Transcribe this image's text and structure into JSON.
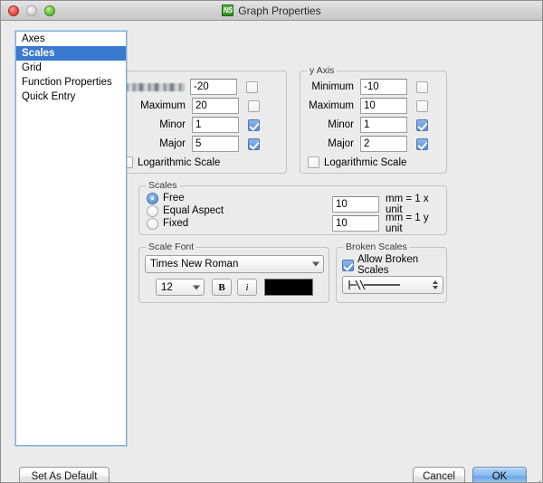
{
  "window": {
    "title": "Graph Properties",
    "app_icon": "application-icon",
    "traffic_lights": [
      "close-button",
      "minimize-button",
      "zoom-button"
    ]
  },
  "sidebar": {
    "items": [
      {
        "label": "Axes",
        "selected": false
      },
      {
        "label": "Scales",
        "selected": true
      },
      {
        "label": "Grid",
        "selected": false
      },
      {
        "label": "Function Properties",
        "selected": false
      },
      {
        "label": "Quick Entry",
        "selected": false
      }
    ]
  },
  "x_axis": {
    "title": "",
    "minimum": {
      "label": "",
      "value": "-20",
      "auto_checked": false
    },
    "maximum": {
      "label": "Maximum",
      "value": "20",
      "auto_checked": false
    },
    "minor": {
      "label": "Minor",
      "value": "1",
      "auto_checked": true
    },
    "major": {
      "label": "Major",
      "value": "5",
      "auto_checked": true
    },
    "logarithmic": {
      "label": "Logarithmic Scale",
      "checked": false
    }
  },
  "y_axis": {
    "title": "y Axis",
    "minimum": {
      "label": "Minimum",
      "value": "-10",
      "auto_checked": false
    },
    "maximum": {
      "label": "Maximum",
      "value": "10",
      "auto_checked": false
    },
    "minor": {
      "label": "Minor",
      "value": "1",
      "auto_checked": true
    },
    "major": {
      "label": "Major",
      "value": "2",
      "auto_checked": true
    },
    "logarithmic": {
      "label": "Logarithmic Scale",
      "checked": false
    }
  },
  "scales": {
    "title": "Scales",
    "options": [
      {
        "label": "Free",
        "selected": true
      },
      {
        "label": "Equal Aspect",
        "selected": false
      },
      {
        "label": "Fixed",
        "selected": false
      }
    ],
    "x_unit": {
      "value": "10",
      "suffix": "mm = 1 x unit"
    },
    "y_unit": {
      "value": "10",
      "suffix": "mm = 1 y unit"
    }
  },
  "scale_font": {
    "title": "Scale Font",
    "family": "Times New Roman",
    "size": "12",
    "bold_label": "B",
    "italic_label": "i",
    "color": "#000000"
  },
  "broken_scales": {
    "title": "Broken Scales",
    "allow": {
      "label": "Allow Broken Scales",
      "checked": true
    },
    "style": "break-mark-line"
  },
  "footer": {
    "set_as_default": "Set As Default",
    "cancel": "Cancel",
    "ok": "OK"
  },
  "colors": {
    "window_background": "#ebebeb",
    "selection_blue": "#3a79d0",
    "accent_blue": "#5b8fd4",
    "default_button_blue": "#8cbcef"
  }
}
